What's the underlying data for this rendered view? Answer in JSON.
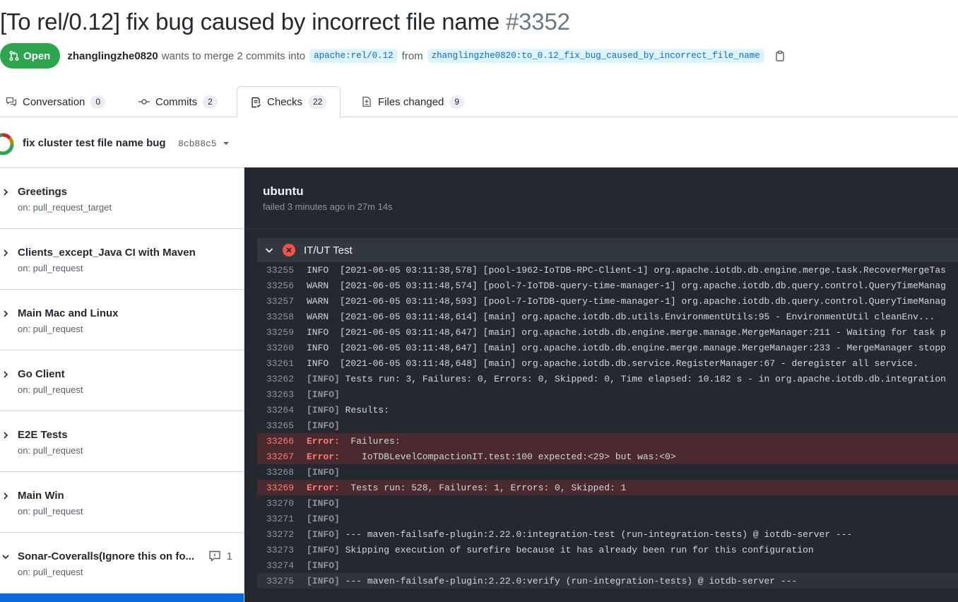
{
  "pr": {
    "title": "[To rel/0.12] fix bug caused by incorrect file name",
    "number": "#3352",
    "state": "Open",
    "author": "zhanglingzhe0820",
    "merge_text": "wants to merge 2 commits into",
    "base_branch": "apache:rel/0.12",
    "from_text": "from",
    "head_branch": "zhanglingzhe0820:to_0.12_fix_bug_caused_by_incorrect_file_name",
    "copy_icon": "copy-icon"
  },
  "tabs": [
    {
      "label": "Conversation",
      "count": "0",
      "icon": "comment-discussion-icon"
    },
    {
      "label": "Commits",
      "count": "2",
      "icon": "git-commit-icon"
    },
    {
      "label": "Checks",
      "count": "22",
      "icon": "checklist-icon",
      "active": true
    },
    {
      "label": "Files changed",
      "count": "9",
      "icon": "file-diff-icon"
    }
  ],
  "commit": {
    "message": "fix cluster test file name bug",
    "sha": "8cb88c5"
  },
  "workflows": [
    {
      "name": "Greetings",
      "trigger": "on: pull_request_target"
    },
    {
      "name": "Clients_except_Java CI with Maven",
      "trigger": "on: pull_request"
    },
    {
      "name": "Main Mac and Linux",
      "trigger": "on: pull_request"
    },
    {
      "name": "Go Client",
      "trigger": "on: pull_request"
    },
    {
      "name": "E2E Tests",
      "trigger": "on: pull_request"
    },
    {
      "name": "Main Win",
      "trigger": "on: pull_request"
    },
    {
      "name": "Sonar-Coveralls(Ignore this on fo...",
      "trigger": "on: pull_request",
      "comments": "1"
    }
  ],
  "job": {
    "name": "ubuntu",
    "status": "failed 3 minutes ago in 27m 14s",
    "step": "IT/UT Test"
  },
  "log": [
    {
      "n": "33255",
      "lvl": "INFO ",
      "text": " [2021-06-05 03:11:38,578] [pool-1962-IoTDB-RPC-Client-1] org.apache.iotdb.db.engine.merge.task.RecoverMergeTas"
    },
    {
      "n": "33256",
      "lvl": "WARN ",
      "text": " [2021-06-05 03:11:48,574] [pool-7-IoTDB-query-time-manager-1] org.apache.iotdb.db.query.control.QueryTimeManag"
    },
    {
      "n": "33257",
      "lvl": "WARN ",
      "text": " [2021-06-05 03:11:48,593] [pool-7-IoTDB-query-time-manager-1] org.apache.iotdb.db.query.control.QueryTimeManag"
    },
    {
      "n": "33258",
      "lvl": "WARN ",
      "text": " [2021-06-05 03:11:48,614] [main] org.apache.iotdb.db.utils.EnvironmentUtils:95 - EnvironmentUtil cleanEnv..."
    },
    {
      "n": "33259",
      "lvl": "INFO ",
      "text": " [2021-06-05 03:11:48,647] [main] org.apache.iotdb.db.engine.merge.manage.MergeManager:211 - Waiting for task p"
    },
    {
      "n": "33260",
      "lvl": "INFO ",
      "text": " [2021-06-05 03:11:48,647] [main] org.apache.iotdb.db.engine.merge.manage.MergeManager:233 - MergeManager stopp"
    },
    {
      "n": "33261",
      "lvl": "INFO ",
      "text": " [2021-06-05 03:11:48,648] [main] org.apache.iotdb.db.service.RegisterManager:67 - deregister all service."
    },
    {
      "n": "33262",
      "tag": "[INFO]",
      "text": " Tests run: 3, Failures: 0, Errors: 0, Skipped: 0, Time elapsed: 10.182 s - in org.apache.iotdb.db.integration"
    },
    {
      "n": "33263",
      "tag": "[INFO]",
      "text": ""
    },
    {
      "n": "33264",
      "tag": "[INFO]",
      "text": " Results:"
    },
    {
      "n": "33265",
      "tag": "[INFO]",
      "text": ""
    },
    {
      "n": "33266",
      "err": "Error: ",
      "text": " Failures:"
    },
    {
      "n": "33267",
      "err": "Error: ",
      "text": "   IoTDBLevelCompactionIT.test:100 expected:<29> but was:<0>"
    },
    {
      "n": "33268",
      "tag": "[INFO]",
      "text": ""
    },
    {
      "n": "33269",
      "err": "Error: ",
      "text": " Tests run: 528, Failures: 1, Errors: 0, Skipped: 1"
    },
    {
      "n": "33270",
      "tag": "[INFO]",
      "text": ""
    },
    {
      "n": "33271",
      "tag": "[INFO]",
      "text": ""
    },
    {
      "n": "33272",
      "tag": "[INFO]",
      "text": " --- maven-failsafe-plugin:2.22.0:integration-test (run-integration-tests) @ iotdb-server ---"
    },
    {
      "n": "33273",
      "tag": "[INFO]",
      "text": " Skipping execution of surefire because it has already been run for this configuration"
    },
    {
      "n": "33274",
      "tag": "[INFO]",
      "text": ""
    },
    {
      "n": "33275",
      "tag": "[INFO]",
      "text": " --- maven-failsafe-plugin:2.22.0:verify (run-integration-tests) @ iotdb-server ---",
      "hl": true
    }
  ],
  "colors": {
    "open_green": "#2da44e",
    "error_red": "#ff7b72",
    "link_blue": "#0969da",
    "log_bg": "#24292f"
  }
}
